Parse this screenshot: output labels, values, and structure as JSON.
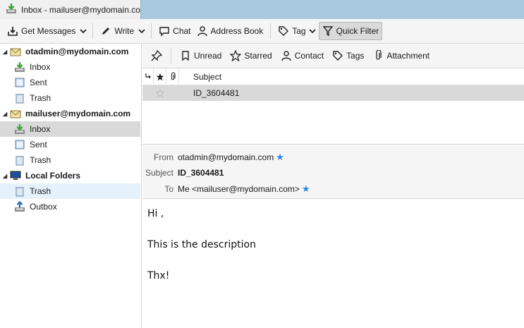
{
  "tab": {
    "title": "Inbox - mailuser@mydomain.com"
  },
  "toolbar": {
    "get_messages": "Get Messages",
    "write": "Write",
    "chat": "Chat",
    "address_book": "Address Book",
    "tag": "Tag",
    "quick_filter": "Quick Filter"
  },
  "folders": {
    "acct1": {
      "name": "otadmin@mydomain.com",
      "inbox": "Inbox",
      "sent": "Sent",
      "trash": "Trash"
    },
    "acct2": {
      "name": "mailuser@mydomain.com",
      "inbox": "Inbox",
      "sent": "Sent",
      "trash": "Trash"
    },
    "local": {
      "name": "Local Folders",
      "trash": "Trash",
      "outbox": "Outbox"
    }
  },
  "quickfilter": {
    "unread": "Unread",
    "starred": "Starred",
    "contact": "Contact",
    "tags": "Tags",
    "attachment": "Attachment"
  },
  "threadpane": {
    "subject_header": "Subject",
    "rows": [
      {
        "subject": "ID_3604481"
      }
    ]
  },
  "message": {
    "from_label": "From",
    "from": "otadmin@mydomain.com",
    "subject_label": "Subject",
    "subject": "ID_3604481",
    "to_label": "To",
    "to": "Me <mailuser@mydomain.com>",
    "body": [
      "Hi ,",
      "This is the description",
      "Thx!"
    ]
  },
  "colors": {
    "accent_star": "#1e88e5",
    "tabstrip": "#a9c9de",
    "selected_row": "#d9d9d9"
  }
}
